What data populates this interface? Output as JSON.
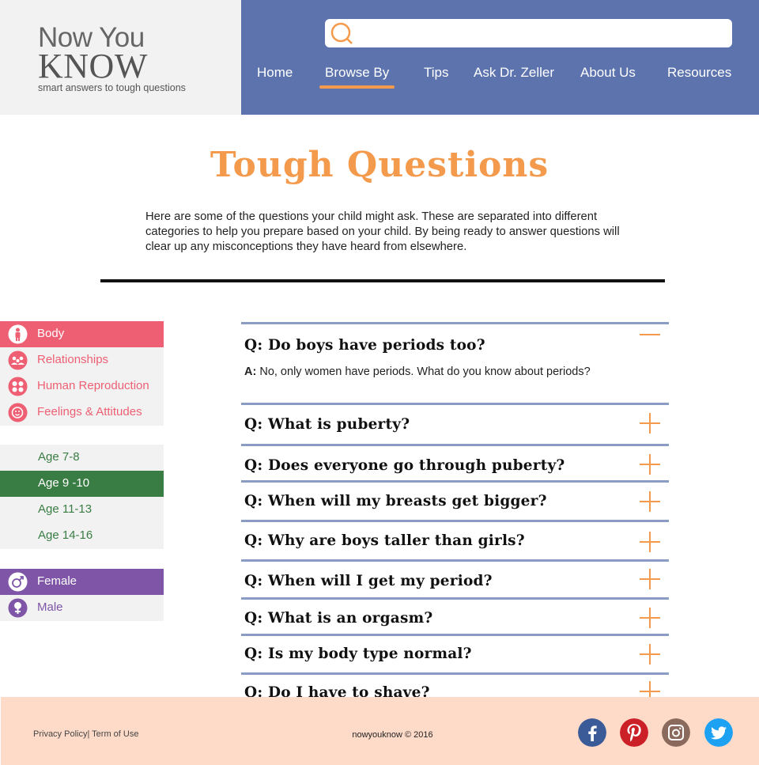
{
  "brand": {
    "line1": "Now You",
    "line2": "KNOW",
    "tagline": "smart answers to tough questions"
  },
  "search": {
    "placeholder": "",
    "icon": "search-icon"
  },
  "nav": {
    "items": [
      "Home",
      "Browse By",
      "Tips",
      "Ask Dr. Zeller",
      "About Us",
      "Resources"
    ],
    "active": "Browse By"
  },
  "page": {
    "title": "Tough Questions",
    "intro": "Here are some of the questions your child might ask. These are separated into different categories to help you prepare based on your child. By being ready to answer questions will clear up any misconceptions they have heard from elsewhere."
  },
  "sidebar": {
    "topics": [
      {
        "label": "Body",
        "icon": "body-icon",
        "active": true
      },
      {
        "label": "Relationships",
        "icon": "relationships-icon",
        "active": false
      },
      {
        "label": "Human Reproduction",
        "icon": "reproduction-icon",
        "active": false
      },
      {
        "label": "Feelings & Attitudes",
        "icon": "feelings-icon",
        "active": false
      }
    ],
    "ages": [
      {
        "label": "Age 7-8",
        "active": false
      },
      {
        "label": "Age 9 -10",
        "active": true
      },
      {
        "label": "Age 11-13",
        "active": false
      },
      {
        "label": "Age 14-16",
        "active": false
      }
    ],
    "genders": [
      {
        "label": "Female",
        "icon": "female-icon",
        "active": true
      },
      {
        "label": "Male",
        "icon": "male-icon",
        "active": false
      }
    ]
  },
  "faq": {
    "answer_prefix": "A:",
    "items": [
      {
        "q": "Q: Do boys have periods too?",
        "expanded": true,
        "a": "No, only women have periods. What do you know about periods?"
      },
      {
        "q": "Q: What is puberty?",
        "expanded": false
      },
      {
        "q": "Q: Does everyone go through puberty?",
        "expanded": false
      },
      {
        "q": "Q: When will my breasts get bigger?",
        "expanded": false
      },
      {
        "q": "Q: Why are boys taller than girls?",
        "expanded": false
      },
      {
        "q": "Q: When will I get my period?",
        "expanded": false
      },
      {
        "q": "Q: What is an orgasm?",
        "expanded": false
      },
      {
        "q": "Q: Is my body type normal?",
        "expanded": false
      },
      {
        "q": "Q: Do I have to shave?",
        "expanded": false
      }
    ]
  },
  "footer": {
    "privacy": "Privacy Policy",
    "separator": "|",
    "terms": " Term of Use",
    "copyright": "nowyouknow © 2016",
    "social": [
      "facebook-icon",
      "pinterest-icon",
      "instagram-icon",
      "twitter-icon"
    ]
  },
  "colors": {
    "header_blue": "#5c73ad",
    "accent_orange": "#f49a4c",
    "topic_pink": "#ee5f73",
    "age_green": "#3a7d44",
    "gender_purple": "#7f55a7",
    "footer_peach": "#fedbc9"
  }
}
